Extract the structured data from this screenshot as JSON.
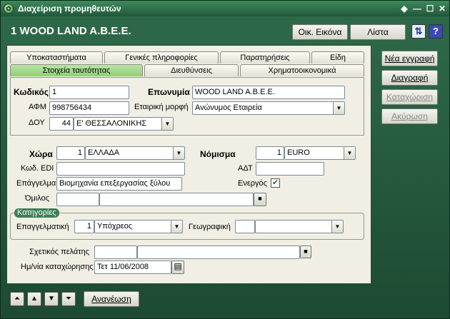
{
  "window": {
    "title": "Διαχείριση προμηθευτών"
  },
  "header": {
    "record_title": "1 WOOD LAND A.B.E.E.",
    "btn_oik": "Οικ. Εικόνα",
    "btn_list": "Λίστα"
  },
  "tabs_row1": [
    "Υποκαταστήματα",
    "Γενικές πληροφορίες",
    "Παρατηρήσεις",
    "Είδη"
  ],
  "tabs_row2": [
    "Στοιχεία ταυτότητας",
    "Διευθύνσεις",
    "Χρηματοοικονομικά"
  ],
  "identity": {
    "code_label": "Κωδικός",
    "code_value": "1",
    "name_label": "Επωνυμία",
    "name_value": "WOOD LAND A.B.E.E.",
    "afm_label": "ΑΦΜ",
    "afm_value": "998756434",
    "form_label": "Εταιρική μορφή",
    "form_value": "Ανώνυμος Εταιρεία",
    "doy_label": "ΔΟΥ",
    "doy_code": "44",
    "doy_value": "Ε' ΘΕΣΣΑΛΟΝΙΚΗΣ"
  },
  "details": {
    "country_label": "Χώρα",
    "country_code": "1",
    "country_value": "ΕΛΛΑΔΑ",
    "currency_label": "Νόμισμα",
    "currency_code": "1",
    "currency_value": "EURO",
    "edi_label": "Κωδ. EDI",
    "edi_value": "",
    "adt_label": "ΑΔΤ",
    "adt_value": "",
    "profession_label": "Επάγγελμα",
    "profession_value": "Βιομηχανία επεξεργασίας ξύλου",
    "active_label": "Ενεργός",
    "active_checked": true,
    "group_label": "Όμιλος",
    "group_code": "",
    "group_value": ""
  },
  "categories": {
    "title": "Κατηγορίες",
    "prof_label": "Επαγγελματική",
    "prof_code": "1",
    "prof_value": "Υπόχρεος",
    "geo_label": "Γεωγραφική",
    "geo_code": "",
    "geo_value": ""
  },
  "related": {
    "client_label": "Σχετικός πελάτης",
    "client_code": "",
    "client_value": "",
    "date_label": "Ημ/νία καταχώρησης",
    "date_value": "Τετ 11/06/2008"
  },
  "side_buttons": {
    "new": "Νέα εγγραφή",
    "delete": "Διαγραφή",
    "save": "Καταχώριση",
    "cancel": "Ακύρωση"
  },
  "footer": {
    "refresh": "Ανανέωση"
  }
}
